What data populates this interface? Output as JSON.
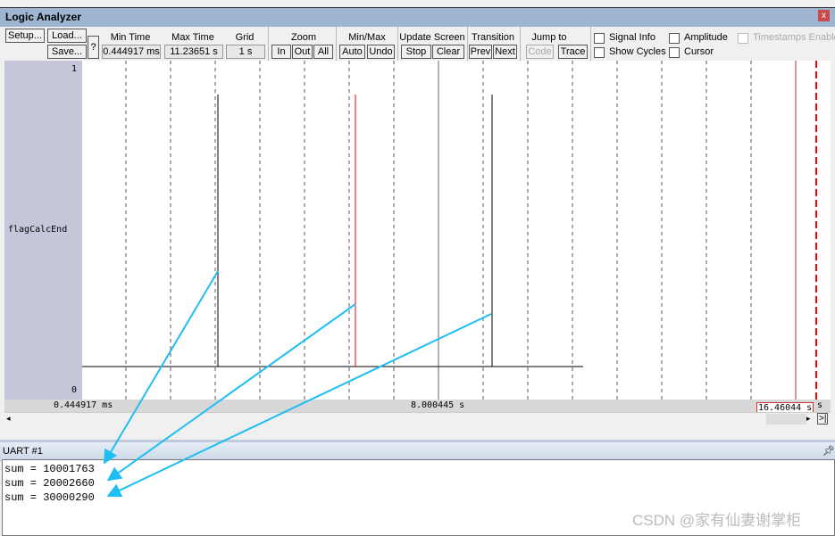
{
  "window": {
    "title": "Logic Analyzer",
    "close": "x"
  },
  "toolbar": {
    "setup": "Setup...",
    "load": "Load...",
    "save": "Save...",
    "help": "?",
    "min_time_label": "Min Time",
    "min_time": "0.444917 ms",
    "max_time_label": "Max Time",
    "max_time": "11.23651 s",
    "grid_label": "Grid",
    "grid": "1 s",
    "zoom_label": "Zoom",
    "zoom_in": "In",
    "zoom_out": "Out",
    "zoom_all": "All",
    "minmax_label": "Min/Max",
    "auto": "Auto",
    "undo": "Undo",
    "update_label": "Update Screen",
    "stop": "Stop",
    "clear": "Clear",
    "transition_label": "Transition",
    "prev": "Prev",
    "next": "Next",
    "jump_label": "Jump to",
    "code": "Code",
    "trace": "Trace",
    "signal_info": "Signal Info",
    "show_cycles": "Show Cycles",
    "amplitude": "Amplitude",
    "cursor": "Cursor",
    "timestamps": "Timestamps Enable"
  },
  "plot": {
    "signal": "flagCalcEnd",
    "y_max": "1",
    "y_min": "0",
    "axis_left": "0.444917 ms",
    "axis_mid": "8.000445 s",
    "cursor_time": "16.46044 s",
    "unit": "s",
    "pulse_color": "#000000",
    "cursor_pulse_color": "#ff0000"
  },
  "uart": {
    "title": "UART #1",
    "pin": "pin-icon",
    "lines": [
      "sum = 10001763",
      "sum = 20002660",
      "sum = 30000290"
    ]
  },
  "watermark": "CSDN @家有仙妻谢掌柜",
  "annotation_color": "#1ebef5"
}
